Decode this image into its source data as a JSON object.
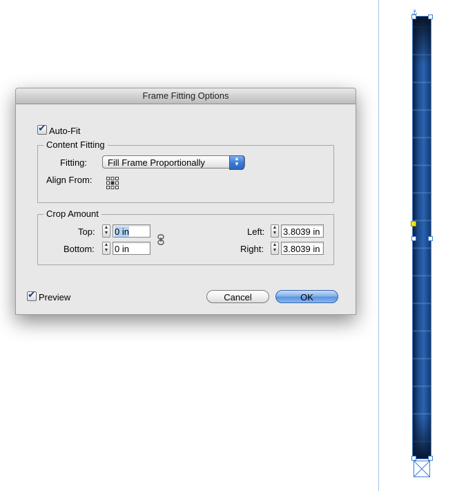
{
  "dialog": {
    "title": "Frame Fitting Options",
    "auto_fit": {
      "label": "Auto-Fit",
      "checked": true
    },
    "content_fitting": {
      "group_label": "Content Fitting",
      "fitting_label": "Fitting:",
      "fitting_value": "Fill Frame Proportionally",
      "align_from_label": "Align From:",
      "align_from_icon": "reference-point-grid-icon"
    },
    "crop_amount": {
      "group_label": "Crop Amount",
      "top_label": "Top:",
      "top_value": "0 in",
      "bottom_label": "Bottom:",
      "bottom_value": "0 in",
      "left_label": "Left:",
      "left_value": "3.8039 in",
      "right_label": "Right:",
      "right_value": "3.8039 in",
      "link_icon": "chain-link-icon"
    },
    "preview": {
      "label": "Preview",
      "checked": true
    },
    "buttons": {
      "cancel": "Cancel",
      "ok": "OK"
    }
  },
  "colors": {
    "accent": "#3d7cd6",
    "frame_handle": "#3d7bd0",
    "center_point": "#f2e21a"
  }
}
